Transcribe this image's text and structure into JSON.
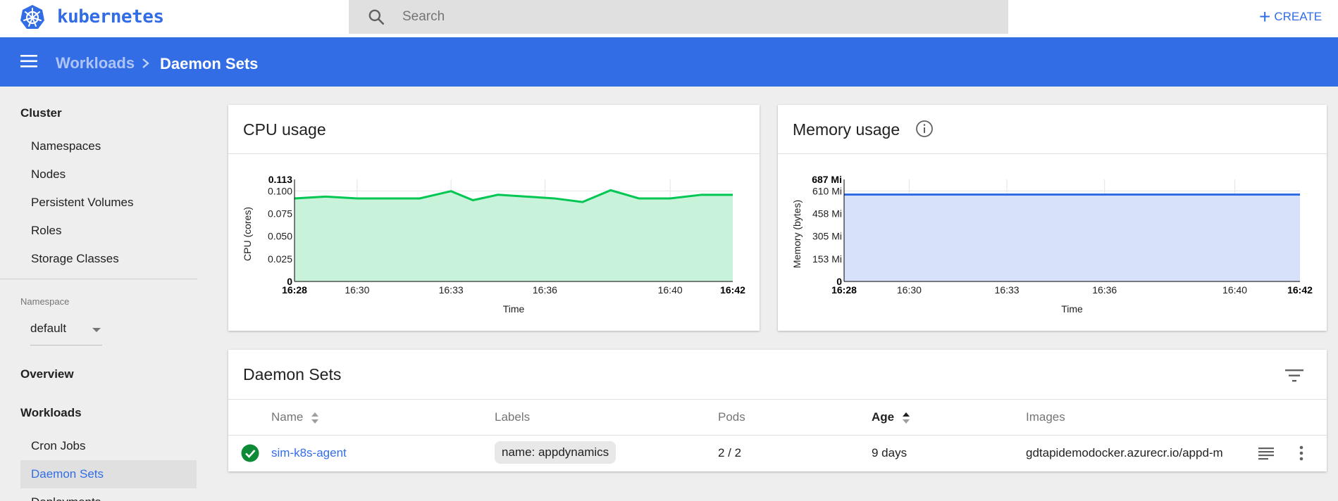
{
  "app": {
    "brand": "kubernetes"
  },
  "search": {
    "placeholder": "Search"
  },
  "header": {
    "create_label": "CREATE"
  },
  "breadcrumb": {
    "parent": "Workloads",
    "current": "Daemon Sets"
  },
  "sidebar": {
    "cluster_heading": "Cluster",
    "cluster_items": [
      "Namespaces",
      "Nodes",
      "Persistent Volumes",
      "Roles",
      "Storage Classes"
    ],
    "namespace_label": "Namespace",
    "namespace_value": "default",
    "overview": "Overview",
    "workloads_heading": "Workloads",
    "workload_items": [
      "Cron Jobs",
      "Daemon Sets",
      "Deployments"
    ],
    "active_item": "Daemon Sets"
  },
  "cpu_card": {
    "title": "CPU usage"
  },
  "memory_card": {
    "title": "Memory usage"
  },
  "chart_data": [
    {
      "type": "area",
      "ylabel": "CPU (cores)",
      "xlabel": "Time",
      "x_ticks": [
        "16:28",
        "16:30",
        "16:33",
        "16:36",
        "16:40",
        "16:42"
      ],
      "y_ticks": [
        "0",
        "0.025",
        "0.050",
        "0.075",
        "0.100",
        "0.113"
      ],
      "ylim": [
        0,
        0.113
      ],
      "x_minutes": [
        28,
        29,
        30,
        31,
        32,
        33,
        33.7,
        34.5,
        35.4,
        36.3,
        37.2,
        38.1,
        39,
        40,
        41,
        42
      ],
      "values": [
        0.092,
        0.094,
        0.092,
        0.092,
        0.092,
        0.1,
        0.09,
        0.096,
        0.094,
        0.092,
        0.088,
        0.101,
        0.092,
        0.092,
        0.096,
        0.096
      ],
      "color": "#00c752",
      "fill": "#c8f2d9"
    },
    {
      "type": "area",
      "ylabel": "Memory (bytes)",
      "xlabel": "Time",
      "x_ticks": [
        "16:28",
        "16:30",
        "16:33",
        "16:36",
        "16:40",
        "16:42"
      ],
      "y_ticks": [
        "0",
        "153 Mi",
        "305 Mi",
        "458 Mi",
        "610 Mi",
        "687 Mi"
      ],
      "ylim": [
        0,
        687
      ],
      "x_minutes": [
        28,
        42
      ],
      "values": [
        585,
        585
      ],
      "color": "#326de6",
      "fill": "#d7e1fa"
    }
  ],
  "daemon_sets": {
    "title": "Daemon Sets",
    "columns": {
      "name": "Name",
      "labels": "Labels",
      "pods": "Pods",
      "age": "Age",
      "images": "Images"
    },
    "rows": [
      {
        "name": "sim-k8s-agent",
        "label": "name: appdynamics",
        "pods": "2 / 2",
        "age": "9 days",
        "images": "gdtapidemodocker.azurecr.io/appd-m",
        "status": "running"
      }
    ]
  },
  "colors": {
    "primary": "#326de6",
    "success": "#0d8a36"
  }
}
